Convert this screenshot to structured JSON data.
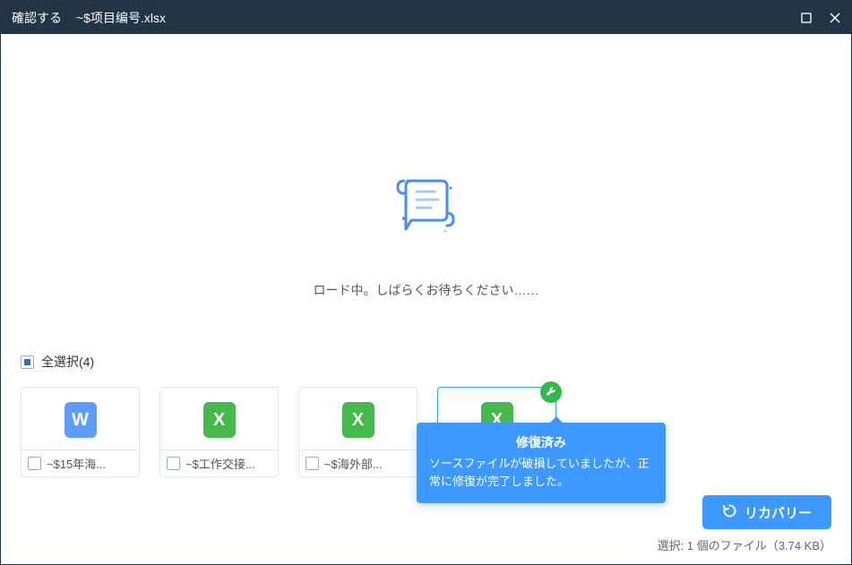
{
  "titlebar": {
    "confirm": "確認する",
    "filename": "~$项目编号.xlsx"
  },
  "loading": {
    "text": "ロード中。しばらくお待ちください……"
  },
  "select_all": {
    "label": "全選択(4)"
  },
  "files": [
    {
      "name": "~$15年海...",
      "type": "word",
      "glyph": "W",
      "selected": false,
      "repaired": false
    },
    {
      "name": "~$工作交接...",
      "type": "excel",
      "glyph": "X",
      "selected": false,
      "repaired": false
    },
    {
      "name": "~$海外部...",
      "type": "excel",
      "glyph": "X",
      "selected": false,
      "repaired": false
    },
    {
      "name": "",
      "type": "excel",
      "glyph": "X",
      "selected": true,
      "repaired": true
    }
  ],
  "tooltip": {
    "title": "修復済み",
    "body": "ソースファイルが破損していましたが、正常に修復が完了しました。"
  },
  "footer": {
    "recover": "リカバリー",
    "status": "選択: 1 個のファイル（3.74 KB）"
  }
}
